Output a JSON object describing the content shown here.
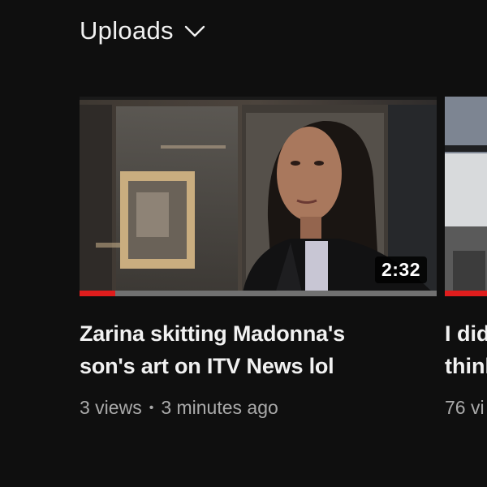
{
  "section": {
    "title": "Uploads",
    "chevron_icon": "chevron-down-icon"
  },
  "videos": [
    {
      "duration": "2:32",
      "title_line1": "Zarina skitting Madonna's",
      "title_line2": "son's art on ITV News lol",
      "views": "3 views",
      "separator": "•",
      "age": "3 minutes ago",
      "watched_fraction": 0.1,
      "colors": {
        "progress": "#e01d1d",
        "track": "#717171"
      }
    },
    {
      "title_line1": "I did",
      "title_line2": "think",
      "views": "76 vi",
      "watched_fraction": 1.0
    }
  ]
}
